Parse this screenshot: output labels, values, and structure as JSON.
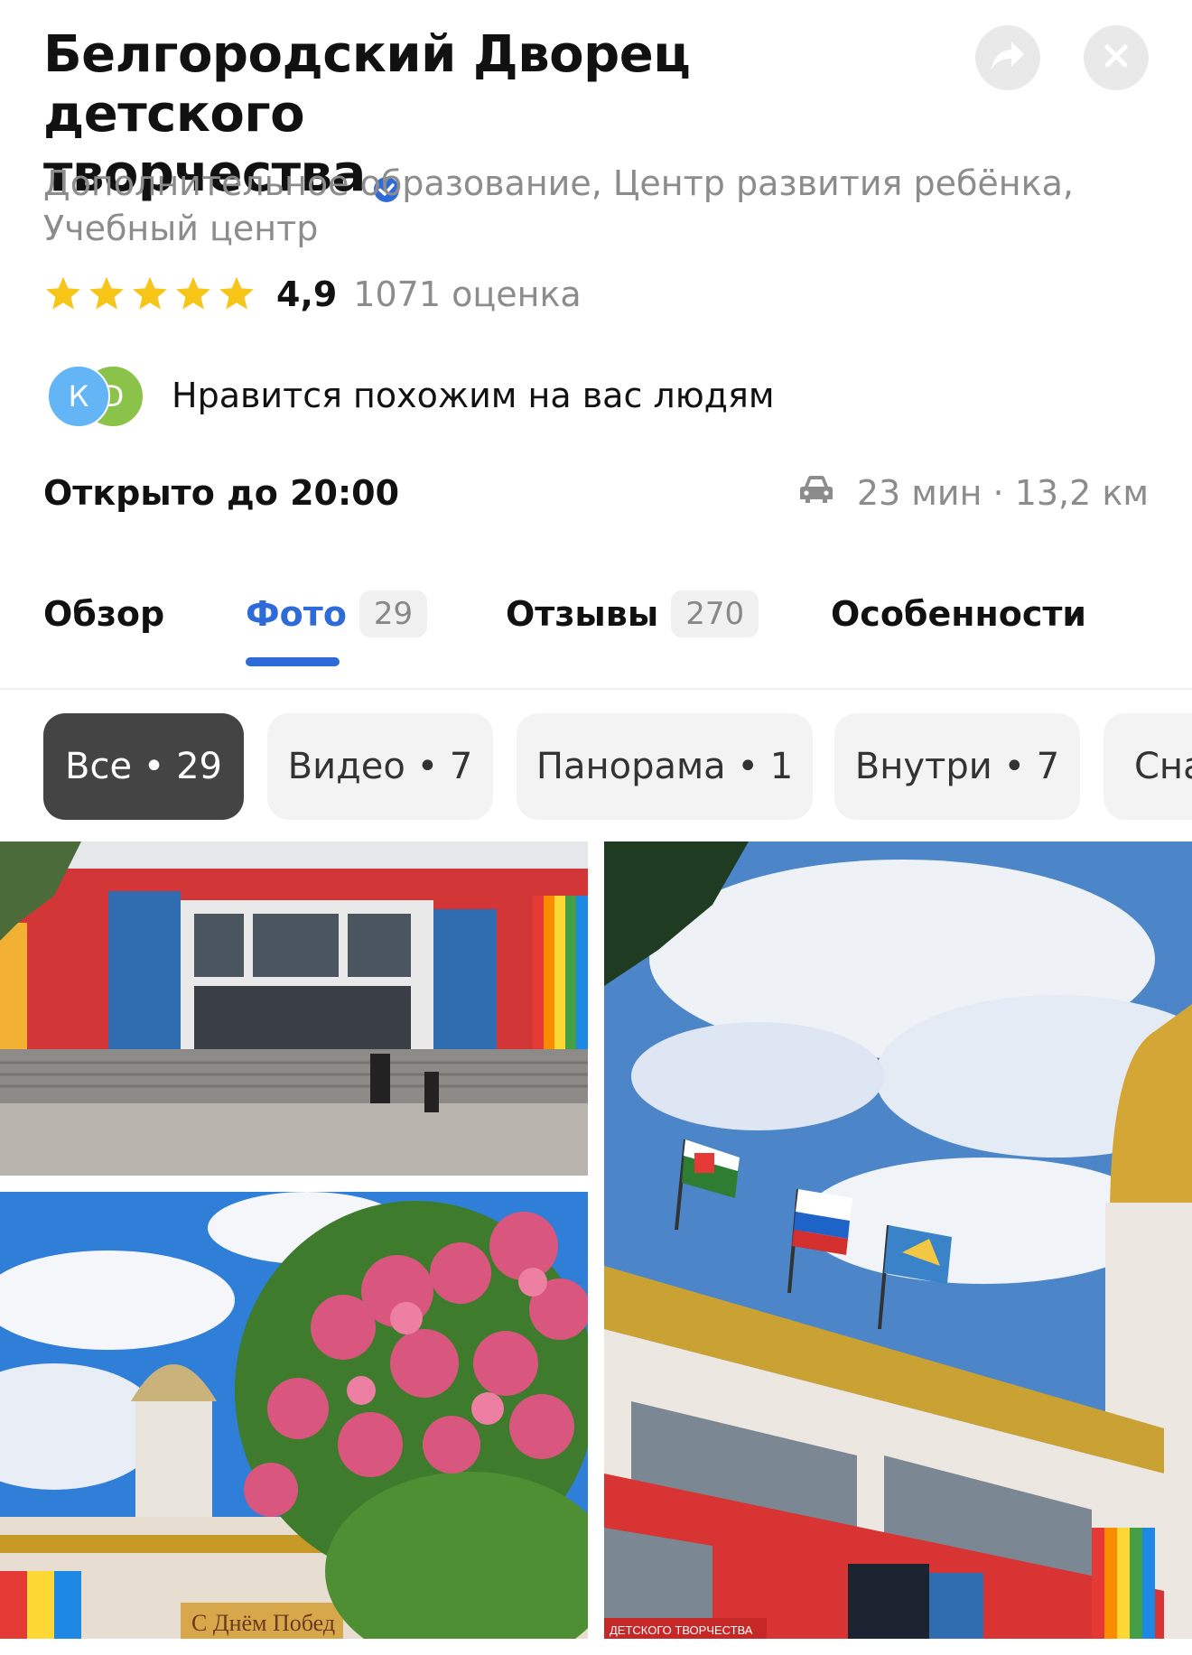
{
  "header": {
    "title_line1": "Белгородский Дворец детского",
    "title_line2": "творчества",
    "categories_line1": "Дополнительное образование, Центр развития ребёнка,",
    "categories_line2": "Учебный центр",
    "rating_value": "4,9",
    "rating_count": "1071 оценка",
    "stars": 5
  },
  "social": {
    "avatar1": "К",
    "avatar2": "D",
    "text": "Нравится похожим на вас людям"
  },
  "status": {
    "hours": "Открыто до 20:00",
    "route": "23 мин · 13,2 км"
  },
  "tabs": [
    {
      "label": "Обзор",
      "count": ""
    },
    {
      "label": "Фото",
      "count": "29"
    },
    {
      "label": "Отзывы",
      "count": "270"
    },
    {
      "label": "Особенности",
      "count": ""
    }
  ],
  "chips": [
    {
      "label": "Все • 29"
    },
    {
      "label": "Видео • 7"
    },
    {
      "label": "Панорама • 1"
    },
    {
      "label": "Внутри • 7"
    },
    {
      "label": "Сна"
    }
  ],
  "photos": {
    "sign_text": "С Днём Побед",
    "banner_text": "ДЕТСКОГО ТВОРЧЕСТВА"
  },
  "colors": {
    "accent": "#2f6bd8",
    "star": "#f7c518",
    "muted": "#8c8c8c"
  }
}
